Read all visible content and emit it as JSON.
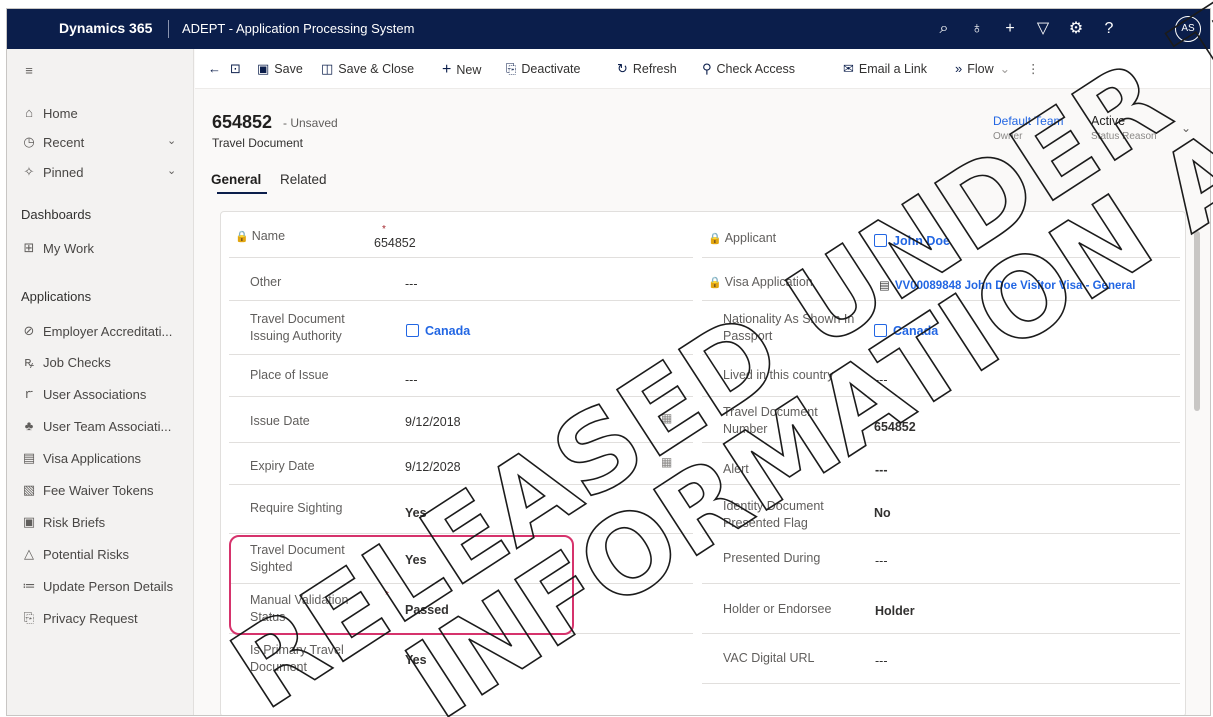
{
  "topbar": {
    "brand": "Dynamics 365",
    "app_title": "ADEPT - Application Processing System",
    "avatar": "AS",
    "icons": [
      "search-icon",
      "lightbulb-icon",
      "plus-icon",
      "filter-icon",
      "gear-icon",
      "help-icon"
    ]
  },
  "sidebar": {
    "items_top": [
      {
        "label": "Home",
        "icon": "home-icon"
      },
      {
        "label": "Recent",
        "icon": "clock-icon"
      },
      {
        "label": "Pinned",
        "icon": "pin-icon"
      }
    ],
    "dashboards_heading": "Dashboards",
    "dashboards": [
      {
        "label": "My Work",
        "icon": "grid-icon"
      }
    ],
    "applications_heading": "Applications",
    "applications": [
      {
        "label": "Employer Accreditati...",
        "icon": "accreditation-icon"
      },
      {
        "label": "Job Checks",
        "icon": "job-icon"
      },
      {
        "label": "User Associations",
        "icon": "user-association-icon"
      },
      {
        "label": "User Team Associati...",
        "icon": "team-icon"
      },
      {
        "label": "Visa Applications",
        "icon": "document-icon"
      },
      {
        "label": "Fee Waiver Tokens",
        "icon": "token-icon"
      },
      {
        "label": "Risk Briefs",
        "icon": "brief-icon"
      },
      {
        "label": "Potential Risks",
        "icon": "warning-icon"
      },
      {
        "label": "Update Person Details",
        "icon": "person-details-icon"
      },
      {
        "label": "Privacy Request",
        "icon": "privacy-icon"
      }
    ]
  },
  "commandbar": {
    "save": "Save",
    "save_close": "Save & Close",
    "new": "New",
    "deactivate": "Deactivate",
    "refresh": "Refresh",
    "check_access": "Check Access",
    "email_link": "Email a Link",
    "flow": "Flow"
  },
  "header": {
    "record_id": "654852",
    "status_suffix": "- Unsaved",
    "entity": "Travel Document",
    "owner_value": "Default Team",
    "owner_label": "Owner",
    "status_value": "Active",
    "status_label": "Status Reason"
  },
  "tabs": [
    "General",
    "Related"
  ],
  "form": {
    "left": [
      {
        "label": "Name",
        "value": "654852",
        "locked": true,
        "required": true
      },
      {
        "label": "Other",
        "value": "---"
      },
      {
        "label": "Travel Document Issuing Authority",
        "value": "Canada",
        "lookup": true
      },
      {
        "label": "Place of Issue",
        "value": "---"
      },
      {
        "label": "Issue Date",
        "value": "9/12/2018",
        "calendar": true
      },
      {
        "label": "Expiry Date",
        "value": "9/12/2028",
        "calendar": true
      },
      {
        "label": "Require Sighting",
        "value": "Yes"
      },
      {
        "label": "Travel Document Sighted",
        "value": "Yes"
      },
      {
        "label": "Manual Validation Status",
        "value": "Passed",
        "required": true
      },
      {
        "label": "Is Primary Travel Document",
        "value": "Yes"
      }
    ],
    "right": [
      {
        "label": "Applicant",
        "value": "John Doe",
        "locked": true,
        "lookup": true
      },
      {
        "label": "Visa Application",
        "value": "VV00089848 John Doe Visitor Visa - General",
        "locked": true
      },
      {
        "label": "Nationality As Shown In Passport",
        "value": "Canada",
        "lookup": true
      },
      {
        "label": "Lived in this country",
        "value": "---"
      },
      {
        "label": "Travel Document Number",
        "value": "654852"
      },
      {
        "label": "Alert",
        "value": "---"
      },
      {
        "label": "Identity Document Presented Flag",
        "value": "No"
      },
      {
        "label": "Presented During",
        "value": "---"
      },
      {
        "label": "Holder or Endorsee",
        "value": "Holder"
      },
      {
        "label": "VAC Digital URL",
        "value": "---"
      }
    ]
  },
  "watermark": {
    "line1": "RELEASED UNDER THE",
    "line2": "INFORMATION ACT"
  },
  "colors": {
    "topbar": "#0b1e4b",
    "link": "#2266e3",
    "highlight": "#d6336c"
  }
}
